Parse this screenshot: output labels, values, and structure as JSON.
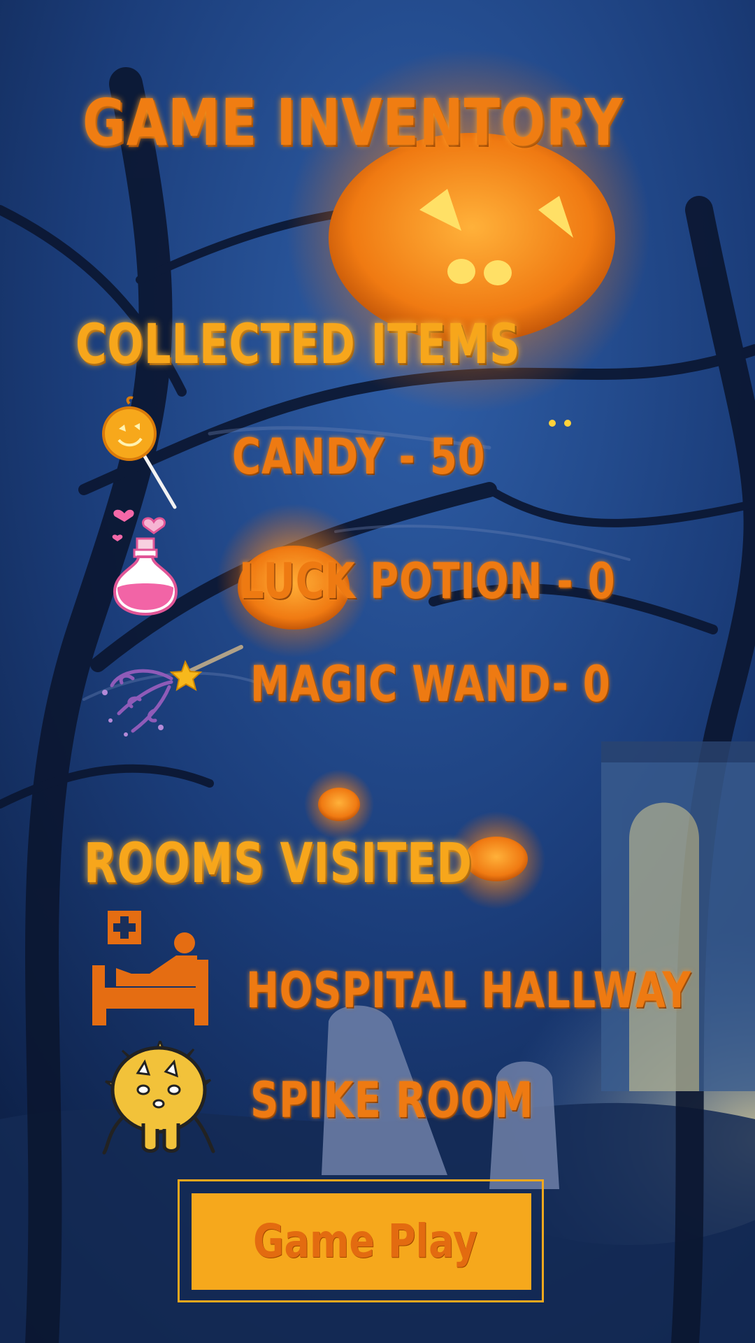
{
  "header": {
    "title": "Game Inventory"
  },
  "collected_items": {
    "heading": "Collected Items",
    "items": [
      {
        "label": "Candy - 50",
        "icon": "lollipop-icon"
      },
      {
        "label": "Luck Potion - 0",
        "icon": "potion-icon"
      },
      {
        "label": "Magic Wand- 0",
        "icon": "magic-wand-icon"
      }
    ]
  },
  "rooms_visited": {
    "heading": "Rooms Visited",
    "rooms": [
      {
        "label": "Hospital Hallway",
        "icon": "hospital-bed-icon"
      },
      {
        "label": "Spike Room",
        "icon": "spike-monster-icon"
      }
    ]
  },
  "actions": {
    "game_play_label": "Game Play"
  },
  "colors": {
    "text_orange": "#ee7a12",
    "heading_orange": "#f7a61b",
    "button_fill": "#f6a81c",
    "background_night": "#0e2148"
  }
}
